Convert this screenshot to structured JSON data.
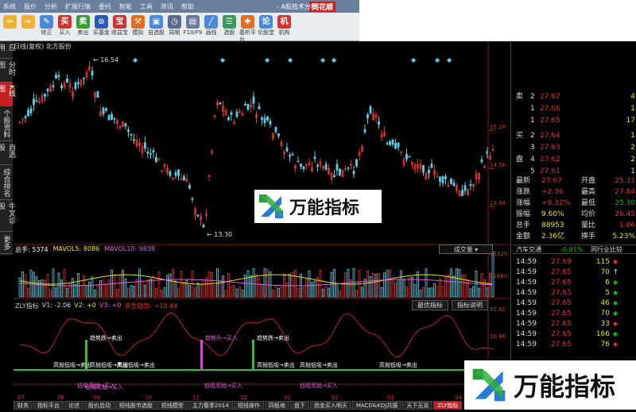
{
  "menu": {
    "items": [
      "系统",
      "报价",
      "分析",
      "扩展行情",
      "委托",
      "智能",
      "工具",
      "资讯",
      "帮助"
    ],
    "logo": "同花顺",
    "window_title": "- A股技术分析"
  },
  "toolbar": {
    "buttons": [
      {
        "label": "",
        "icon": "back-arrow-icon",
        "color": "#f0b030",
        "glyph": "⇦"
      },
      {
        "label": "",
        "icon": "forward-arrow-icon",
        "color": "#f0b030",
        "glyph": "⇨"
      },
      {
        "label": "修正",
        "icon": "pencil-icon",
        "color": "#4a8ad8",
        "glyph": "✎"
      },
      {
        "label": "买入",
        "icon": "buy-icon",
        "color": "#d83030",
        "glyph": "买"
      },
      {
        "label": "卖出",
        "icon": "sell-icon",
        "color": "#30a030",
        "glyph": "卖"
      },
      {
        "label": "买基金",
        "icon": "fund-icon",
        "color": "#2a5ab8",
        "glyph": "⊙"
      },
      {
        "label": "收益宝",
        "icon": "treasure-icon",
        "color": "#d83030",
        "glyph": "宝"
      },
      {
        "label": "模拟",
        "icon": "hammer-icon",
        "color": "#e07020",
        "glyph": "⚒"
      },
      {
        "label": "自选股",
        "icon": "portfolio-icon",
        "color": "#4a8ad8",
        "glyph": "▣"
      },
      {
        "label": "周期",
        "icon": "clock-icon",
        "color": "#5a6a8a",
        "glyph": "◷"
      },
      {
        "label": "F10/F9",
        "icon": "f10-icon",
        "color": "#6a7a9a",
        "glyph": "▤"
      },
      {
        "label": "画线",
        "icon": "drawline-icon",
        "color": "#4a8ad8",
        "glyph": "╱"
      },
      {
        "label": "选股",
        "icon": "filter-icon",
        "color": "#3a9a5a",
        "glyph": "☰"
      },
      {
        "label": "基析平台",
        "icon": "platform-icon",
        "color": "#e07020",
        "glyph": "✚"
      },
      {
        "label": "论股堂",
        "icon": "forum-icon",
        "color": "#4a8ad8",
        "glyph": "论"
      },
      {
        "label": "机构",
        "icon": "institution-icon",
        "color": "#d83030",
        "glyph": "机"
      }
    ]
  },
  "left_tabs": [
    "应用",
    "分时图",
    "K线图",
    "个股资料",
    "自选股",
    "综合排名",
    "牛叉诊股",
    "更多"
  ],
  "chart": {
    "title": "日线(复权) 北方股份",
    "price_high_label": "16.54",
    "price_low_label": "13.30",
    "price_axis": [
      "15.28",
      "14.56",
      "13.84"
    ],
    "volume": {
      "label": "总手: 5374",
      "ma5": "MAVOL5: 8086",
      "ma10": "MAVOL10: 9838",
      "dropdown": "成交量",
      "axis": [
        "63320",
        "31660"
      ]
    },
    "indicator": {
      "name": "ZLY指标",
      "v1": "V1: -2.06",
      "v2": "V2: +0",
      "v3": "V3: +0",
      "v4": "资金趋势: +18.44",
      "axis": [
        "92.62",
        "50.86",
        "0.00"
      ],
      "btn_best": "最优指标",
      "btn_help": "指标说明",
      "signals": [
        "趋势跌→卖出",
        "趋势升→买入",
        "趋势跌→卖出",
        "高抛低吸→卖出",
        "高抛低吸→卖出",
        "高抛低吸→卖出",
        "低吸高抛→买入",
        "高抛低吸→卖出",
        "高抛低吸→卖出",
        "高抛低吸→卖出",
        "低吸高抛→买入",
        "低吸高抛→买入",
        "低吸高抛→买入"
      ]
    },
    "dates": [
      "07",
      "08",
      "09",
      "10",
      "11",
      "12",
      "01",
      "02",
      "03",
      "04"
    ]
  },
  "bottom_tabs": [
    "财务",
    "指标平台",
    "论述",
    "股价启动",
    "短线股市选股",
    "短线模型",
    "主力春季2014",
    "短线操作",
    "四板地",
    "盘下",
    "资金买入明天",
    "MACD&KDJ共振",
    "天下无双",
    "ZLY指标"
  ],
  "order_book": {
    "sell": [
      {
        "label": "卖",
        "no": "2",
        "price": "27.67",
        "vol": "4"
      },
      {
        "label": "",
        "no": "1",
        "price": "27.66",
        "vol": "1"
      },
      {
        "label": "",
        "no": "1",
        "price": "27.65",
        "vol": "17"
      }
    ],
    "buy": [
      {
        "label": "买",
        "no": "2",
        "price": "27.64",
        "vol": "1"
      },
      {
        "label": "",
        "no": "3",
        "price": "27.63",
        "vol": "2"
      },
      {
        "label": "盘",
        "no": "4",
        "price": "27.62",
        "vol": "2"
      },
      {
        "label": "",
        "no": "5",
        "price": "27.61",
        "vol": "1"
      }
    ]
  },
  "quote": [
    {
      "l1": "最新",
      "v1": "27.67",
      "c1": "red",
      "l2": "开盘",
      "v2": "25.31",
      "c2": "red"
    },
    {
      "l1": "涨跌",
      "v1": "+2.36",
      "c1": "red",
      "l2": "最高",
      "v2": "27.84",
      "c2": "red"
    },
    {
      "l1": "涨幅",
      "v1": "+9.32%",
      "c1": "red",
      "l2": "最低",
      "v2": "25.30",
      "c2": "grn"
    },
    {
      "l1": "振幅",
      "v1": "9.60%",
      "c1": "yel",
      "l2": "均价",
      "v2": "26.45",
      "c2": "red"
    },
    {
      "l1": "总手",
      "v1": "88953",
      "c1": "yel",
      "l2": "量比",
      "v2": "1.86",
      "c2": "red"
    },
    {
      "l1": "金额",
      "v1": "2.36亿",
      "c1": "yel",
      "l2": "换手",
      "v2": "5.23%",
      "c2": "yel"
    }
  ],
  "peer": {
    "name": "汽车交通",
    "change": "-0.91%",
    "compare": "同行业比较"
  },
  "ticks": [
    {
      "t": "14:59",
      "p": "27.69",
      "v": "115",
      "a": "◆",
      "ac": "red"
    },
    {
      "t": "14:59",
      "p": "27.65",
      "v": "70",
      "a": "↑",
      "ac": "wht"
    },
    {
      "t": "14:59",
      "p": "27.65",
      "v": "6",
      "a": "◆",
      "ac": "grn"
    },
    {
      "t": "14:59",
      "p": "27.65",
      "v": "5",
      "a": "◆",
      "ac": "grn"
    },
    {
      "t": "14:59",
      "p": "27.65",
      "v": "46",
      "a": "◆",
      "ac": "grn"
    },
    {
      "t": "14:59",
      "p": "27.65",
      "v": "70",
      "a": "◆",
      "ac": "grn"
    },
    {
      "t": "14:59",
      "p": "27.65",
      "v": "33",
      "a": "◆",
      "ac": "red"
    },
    {
      "t": "14:59",
      "p": "27.65",
      "v": "166",
      "a": "◆",
      "ac": "grn"
    },
    {
      "t": "14:59",
      "p": "27.65",
      "v": "76",
      "a": "◆",
      "ac": "red"
    }
  ],
  "watermark": {
    "text": "万能指标"
  },
  "colors": {
    "up": "#e03030",
    "down": "#5ad0e8",
    "ma": "#e5e500"
  }
}
